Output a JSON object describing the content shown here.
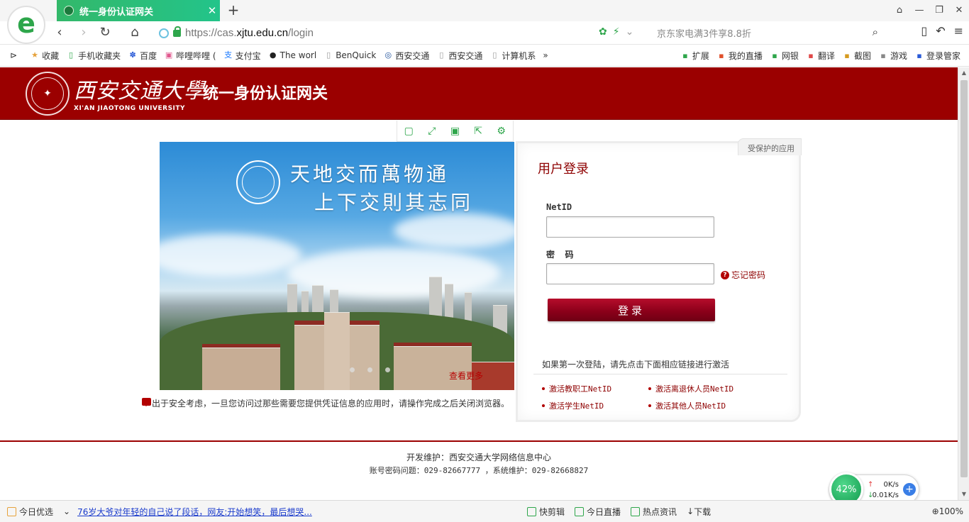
{
  "browser": {
    "logo_letter": "e",
    "tab": {
      "title": "统一身份认证网关"
    },
    "url": {
      "prefix": "https://cas.",
      "domain": "xjtu.edu.cn",
      "path": "/login"
    },
    "search_placeholder": "京东家电满3件享8.8折",
    "bookmarks": [
      {
        "label": "收藏",
        "icon": "star-icon"
      },
      {
        "label": "手机收藏夹",
        "icon": "phone-icon"
      },
      {
        "label": "百度",
        "icon": "paw-icon"
      },
      {
        "label": "哔哩哔哩 (",
        "icon": "tv-icon"
      },
      {
        "label": "支付宝",
        "icon": "alipay-icon"
      },
      {
        "label": "The worl",
        "icon": "github-icon"
      },
      {
        "label": "BenQuick",
        "icon": "page-icon"
      },
      {
        "label": "西安交通",
        "icon": "seal-icon"
      },
      {
        "label": "西安交通",
        "icon": "page-icon"
      },
      {
        "label": "计算机系",
        "icon": "page-icon"
      }
    ],
    "bookmark_tools": [
      {
        "label": "扩展"
      },
      {
        "label": "我的直播"
      },
      {
        "label": "网银"
      },
      {
        "label": "翻译"
      },
      {
        "label": "截图"
      },
      {
        "label": "游戏"
      },
      {
        "label": "登录管家"
      }
    ]
  },
  "header": {
    "univ_cn": "西安交通大學",
    "univ_en": "XI'AN JIAOTONG UNIVERSITY",
    "title": "统一身份认证网关"
  },
  "banner": {
    "motto_line1": "天地交而萬物通",
    "motto_line2": "上下交則其志同",
    "view_link": "查看更多"
  },
  "notice": "出于安全考虑，一旦您访问过那些需要您提供凭证信息的应用时，请操作完成之后关闭浏览器。",
  "login": {
    "protected_apps": "受保护的应用",
    "title": "用户登录",
    "netid_label": "NetID",
    "password_label": "密  码",
    "forgot": "忘记密码",
    "submit": "登录",
    "first_hint": "如果第一次登陆，请先点击下面相应链接进行激活",
    "activate": [
      "激活教职工NetID",
      "激活离退休人员NetID",
      "激活学生NetID",
      "激活其他人员NetID"
    ]
  },
  "footer": {
    "line1": "开发维护：西安交通大学网络信息中心",
    "line2": "账号密码问题：029-82667777 ，系统维护：029-82668827"
  },
  "speed": {
    "percent": "42%",
    "up": "0K/s",
    "down": "0.01K/s"
  },
  "status": {
    "today_pick": "今日优选",
    "news": "76岁大爷对年轻的自己说了段话，网友:开始想笑，最后想哭...",
    "items": [
      "快剪辑",
      "今日直播",
      "热点资讯"
    ],
    "download": "下载",
    "zoom": "100%"
  }
}
